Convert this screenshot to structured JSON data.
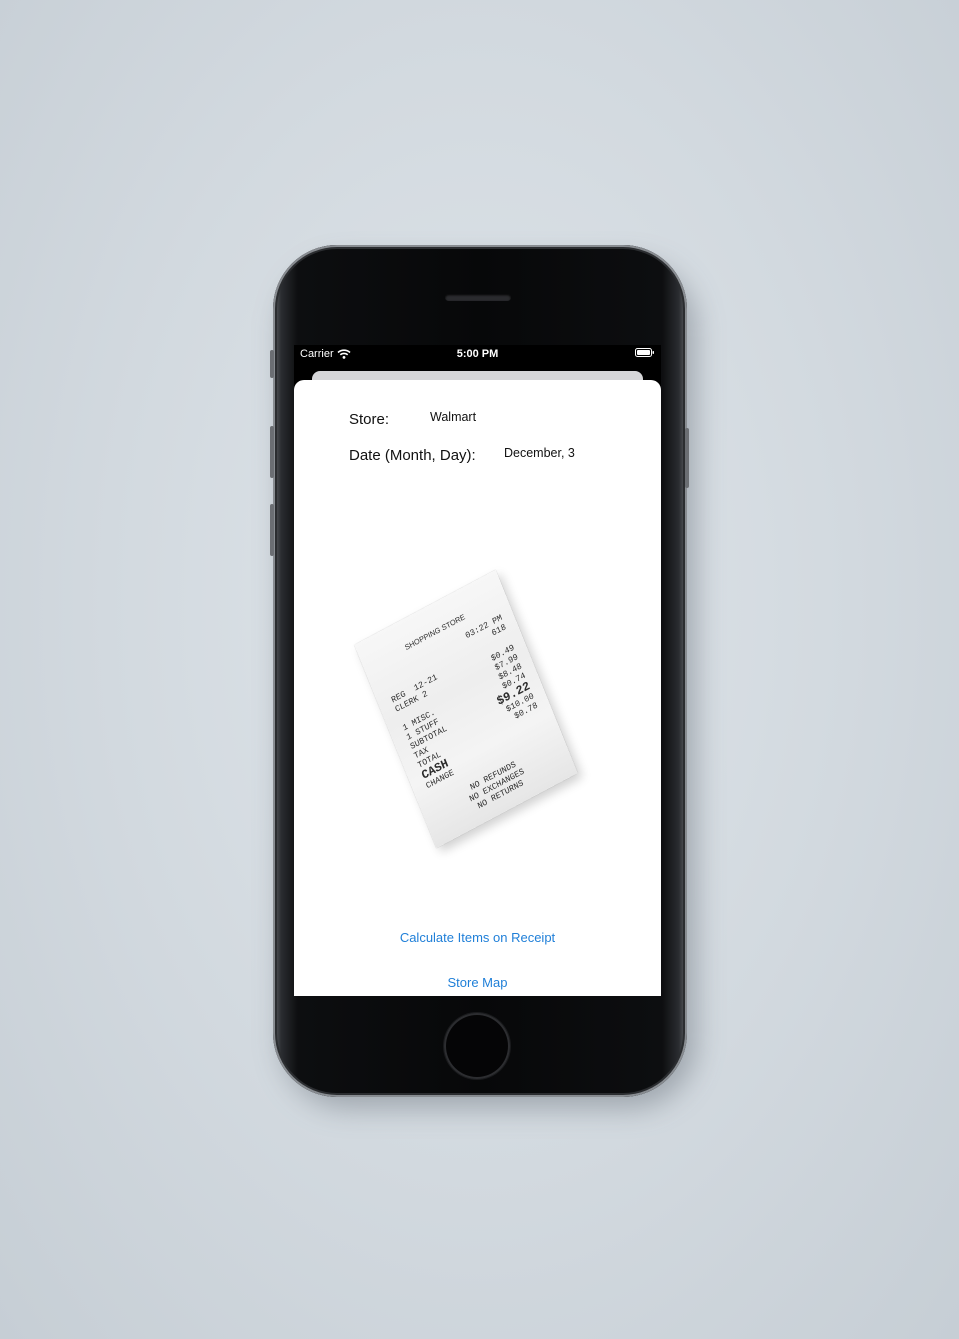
{
  "status_bar": {
    "carrier": "Carrier",
    "time": "5:00 PM"
  },
  "form": {
    "store_label": "Store:",
    "store_value": "Walmart",
    "date_label": "Date (Month, Day):",
    "date_value": "December, 3"
  },
  "receipt": {
    "store_name": "SHOPPING STORE",
    "time": "03:22 PM",
    "number": "618",
    "reg": "REG  12-21",
    "clerk": "CLERK 2",
    "lines_left": [
      "1 MISC.",
      "1 STUFF",
      "SUBTOTAL",
      "TAX",
      "TOTAL",
      "CASH",
      "CHANGE"
    ],
    "amounts": [
      "$0.49",
      "$7.99",
      "$8.48",
      "$0.74",
      "$9.22",
      "$10.00",
      "$0.78"
    ],
    "footer": [
      "NO REFUNDS",
      "NO EXCHANGES",
      "NO RETURNS"
    ]
  },
  "actions": {
    "calculate_label": "Calculate Items on Receipt",
    "store_map_label": "Store Map"
  }
}
